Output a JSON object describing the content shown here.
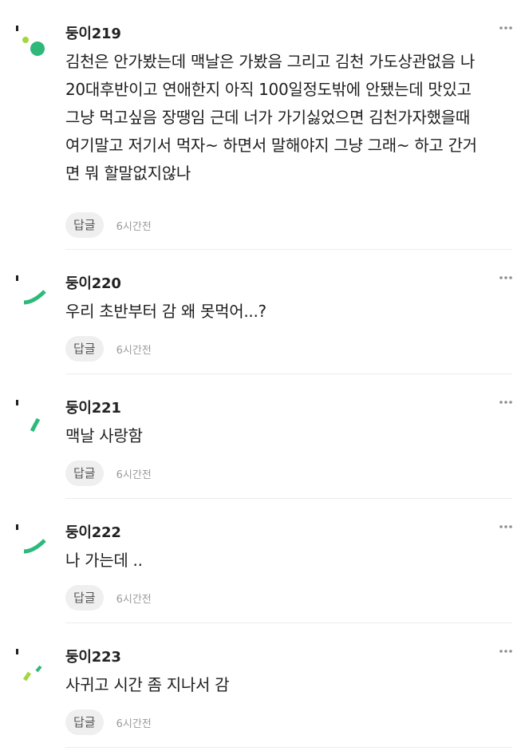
{
  "comments": [
    {
      "username": "둥이219",
      "text": "김천은 안가봤는데 맥날은 가봤음 그리고 김천 가도상관없음 나\n20대후반이고 연애한지 아직 100일정도밖에 안됐는데 맛있고\n그냥 먹고싶음 장땡임 근데 너가 가기싫었으면 김천가자했을때\n여기말고 저기서 먹자~ 하면서 말해야지 그냥 그래~ 하고 간거\n면 뭐 할말없지않나",
      "reply_label": "답글",
      "time": "6시간전",
      "more_label": "···"
    },
    {
      "username": "둥이220",
      "text": "우리 초반부터 감 왜 못먹어...?",
      "reply_label": "답글",
      "time": "6시간전",
      "more_label": "···"
    },
    {
      "username": "둥이221",
      "text": "맥날 사랑함",
      "reply_label": "답글",
      "time": "6시간전",
      "more_label": "···"
    },
    {
      "username": "둥이222",
      "text": "나 가는데 ..",
      "reply_label": "답글",
      "time": "6시간전",
      "more_label": "···"
    },
    {
      "username": "둥이223",
      "text": "사귀고 시간 좀 지나서 감",
      "reply_label": "답글",
      "time": "6시간전",
      "more_label": "···"
    }
  ],
  "colors": {
    "avatar_green": "#2eb97b",
    "avatar_lime": "#a3d63f",
    "avatar_dark": "#1f1f1f"
  },
  "icons": {
    "more": "more-dots-icon"
  }
}
